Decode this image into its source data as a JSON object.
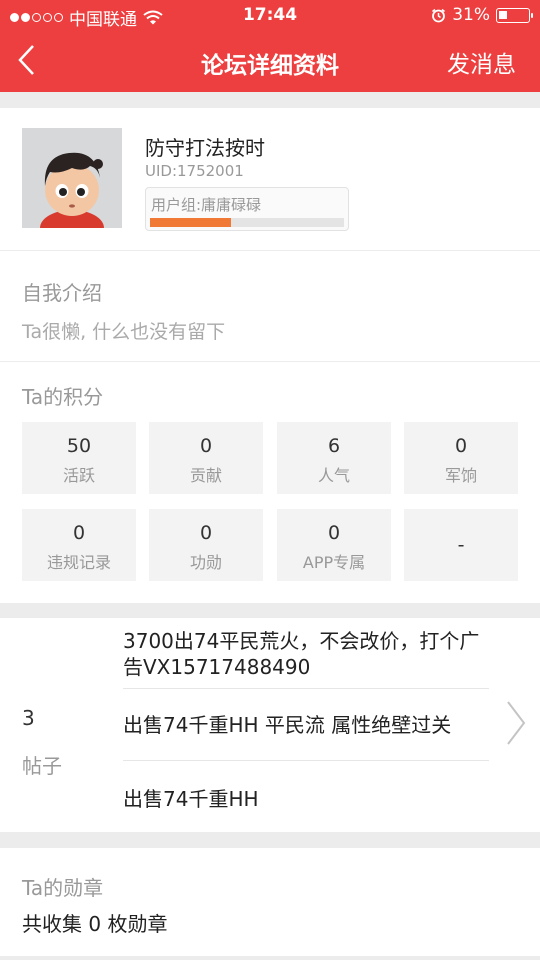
{
  "status_bar": {
    "carrier": "中国联通",
    "time": "17:44",
    "battery": "31%",
    "battery_level": 0.31
  },
  "nav": {
    "title": "论坛详细资料",
    "action": "发消息"
  },
  "profile": {
    "name": "防守打法按时",
    "uid": "UID:1752001",
    "group": "用户组:庸庸碌碌",
    "group_progress": 0.42,
    "progress_color": "#f07a35"
  },
  "intro": {
    "title": "自我介绍",
    "text": "Ta很懒, 什么也没有留下"
  },
  "score": {
    "title": "Ta的积分",
    "items": [
      {
        "value": "50",
        "label": "活跃"
      },
      {
        "value": "0",
        "label": "贡献"
      },
      {
        "value": "6",
        "label": "人气"
      },
      {
        "value": "0",
        "label": "军饷"
      },
      {
        "value": "0",
        "label": "违规记录"
      },
      {
        "value": "0",
        "label": "功勋"
      },
      {
        "value": "0",
        "label": "APP专属"
      },
      {
        "value": "-",
        "label": ""
      }
    ]
  },
  "posts": {
    "count": "3",
    "label": "帖子",
    "items": [
      "3700出74平民荒火，不会改价，打个广告VX15717488490",
      "出售74千重HH 平民流 属性绝壁过关",
      "出售74千重HH"
    ]
  },
  "medals": {
    "title": "Ta的勋章",
    "text": "共收集 0 枚勋章"
  },
  "colors": {
    "header": "#ed3f3f",
    "background": "#ececec"
  }
}
